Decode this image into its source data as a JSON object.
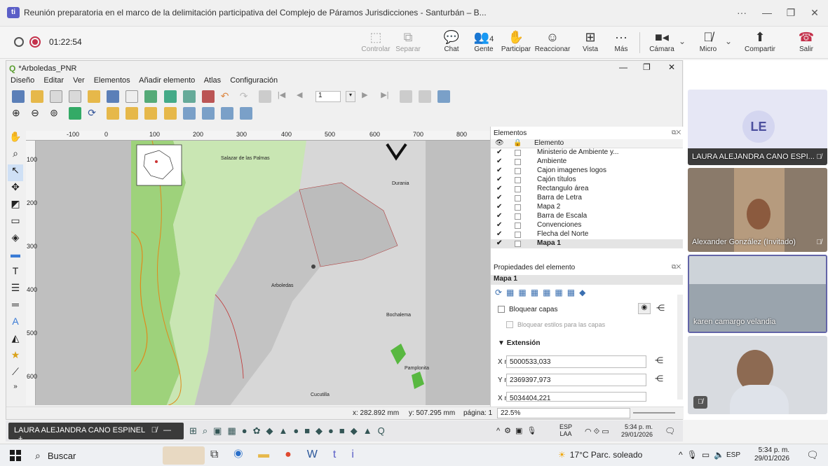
{
  "teams": {
    "window_title": "Reunión preparatoria en el marco de la delimitación participativa del Complejo de Páramos Jurisdicciones - Santurbán – B...",
    "timer": "01:22:54",
    "tools": [
      {
        "label": "Controlar",
        "icon": "control-icon"
      },
      {
        "label": "Separar",
        "icon": "pop-out-icon"
      },
      {
        "label": "Chat",
        "icon": "chat-icon"
      },
      {
        "label": "Gente",
        "icon": "people-icon",
        "count": "4"
      },
      {
        "label": "Participar",
        "icon": "raise-hand-icon"
      },
      {
        "label": "Reaccionar",
        "icon": "emoji-icon"
      },
      {
        "label": "Vista",
        "icon": "grid-icon"
      },
      {
        "label": "Más",
        "icon": "more-icon"
      },
      {
        "label": "Cámara",
        "icon": "camera-icon"
      },
      {
        "label": "Micro",
        "icon": "mic-off-icon"
      },
      {
        "label": "Compartir",
        "icon": "share-icon"
      },
      {
        "label": "Salir",
        "icon": "hangup-icon"
      }
    ]
  },
  "qgis": {
    "title": "*Arboledas_PNR",
    "menu": [
      "Diseño",
      "Editar",
      "Ver",
      "Elementos",
      "Añadir elemento",
      "Atlas",
      "Configuración"
    ],
    "ruler": [
      "-100",
      "0",
      "100",
      "200",
      "300",
      "400",
      "500",
      "600",
      "700",
      "800"
    ],
    "vruler": [
      "100",
      "200",
      "300",
      "400",
      "500",
      "600"
    ],
    "map_labels": [
      "Salazar de las Palmas",
      "Durania",
      "Arboledas",
      "Bochalema",
      "Cucutilla",
      "Pamplonita"
    ],
    "elements_title": "Elementos",
    "element_header": "Elemento",
    "elements": [
      "Ministerio de Ambiente y...",
      "Ambiente",
      "Cajon imagenes logos",
      "Cajón títulos",
      "Rectangulo área",
      "Barra de Letra",
      "Mapa 2",
      "Barra de Escala",
      "Convenciones",
      "Flecha del Norte",
      "Mapa 1"
    ],
    "props_title": "Propiedades del elemento",
    "props_item": "Mapa 1",
    "lock_layers": "Bloquear capas",
    "lock_styles": "Bloquear estilos para las capas",
    "extent_title": "Extensión",
    "xmin_label": "X mín",
    "xmin": "5000533,033",
    "ymin_label": "Y mín",
    "ymin": "2369397,973",
    "xmax_label": "X máx",
    "xmax": "5034404,221",
    "status_x": "x: 282.892 mm",
    "status_y": "y: 507.295 mm",
    "status_page": "página: 1",
    "zoom": "22.5%"
  },
  "participants": [
    {
      "name": "LAURA ALEJANDRA CANO ESPI...",
      "initials": "LE"
    },
    {
      "name": "Alexander González (Invitado)"
    },
    {
      "name": "karen camargo velandia"
    },
    {
      "name": ""
    }
  ],
  "share_bar": {
    "presenter": "LAURA ALEJANDRA CANO ESPINEL",
    "time": "5:34 p. m.",
    "date": "29/01/2026",
    "lang": "ESP",
    "lang2": "LAA"
  },
  "taskbar": {
    "search": "Buscar",
    "weather": "17°C  Parc. soleado",
    "lang": "ESP",
    "time": "5:34 p. m.",
    "date": "29/01/2026"
  },
  "colors": {
    "teams": "#5b5fc7",
    "hangup": "#c4314b",
    "selected_tile": "#6264a7",
    "map_green": "#9ed27b",
    "map_gray": "#cfcfcf"
  }
}
